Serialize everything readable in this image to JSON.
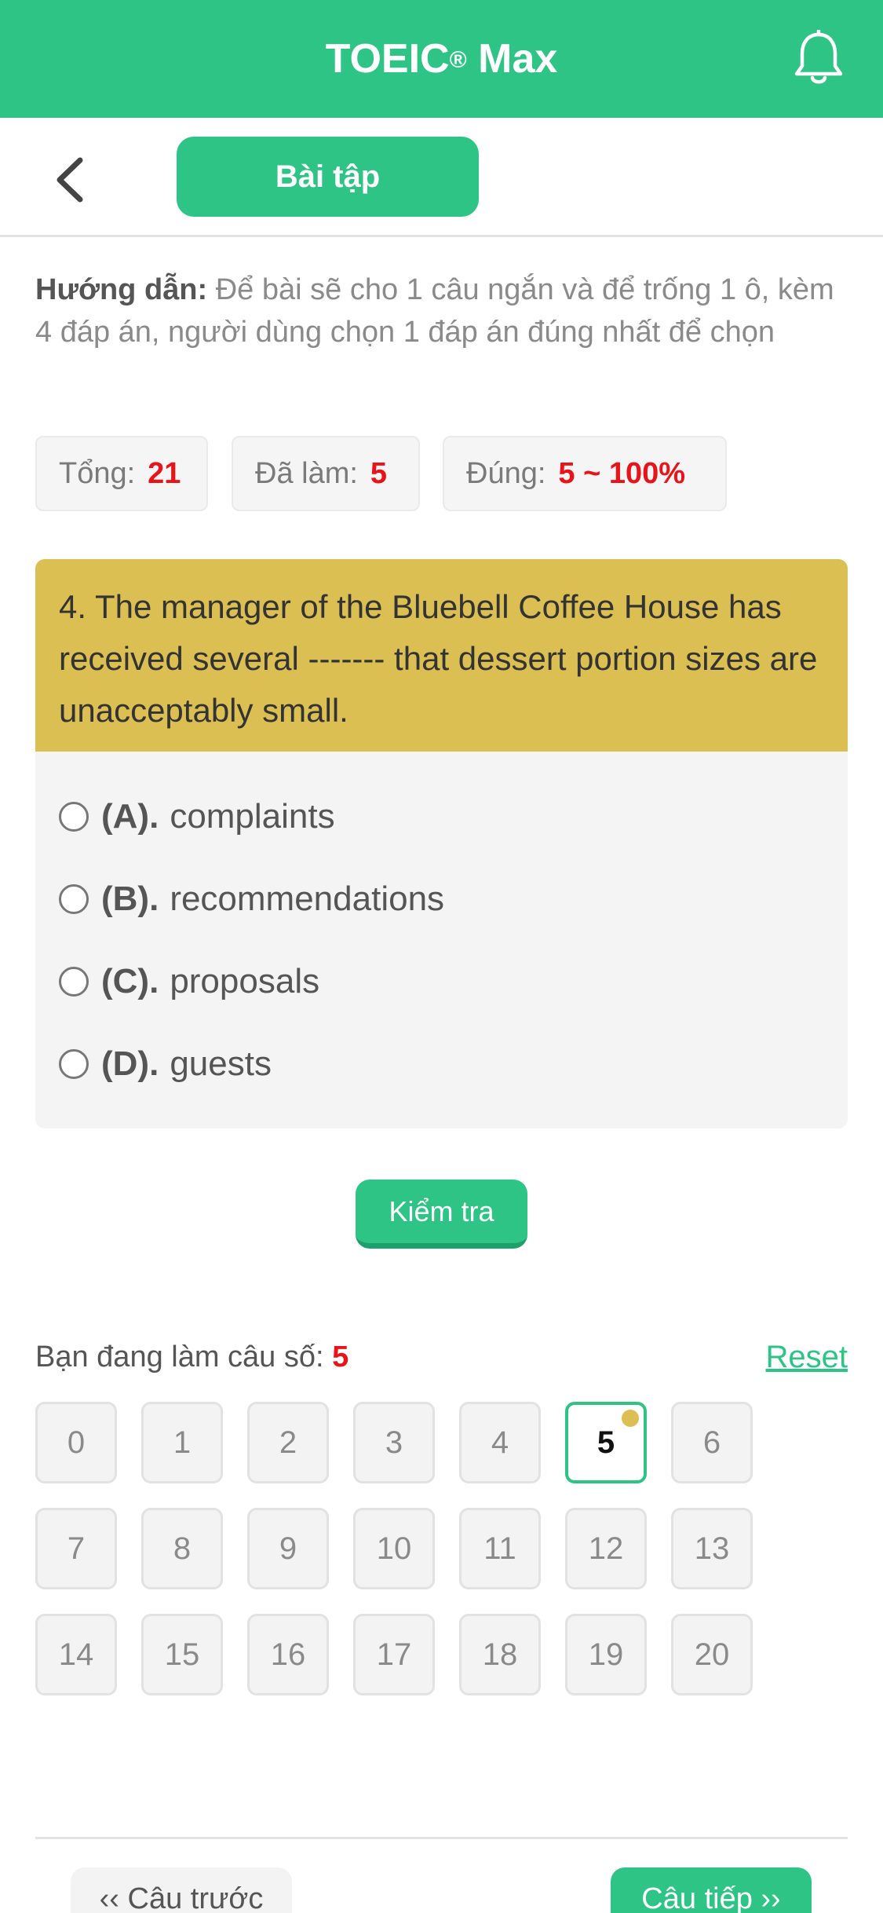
{
  "header": {
    "title": "TOEIC",
    "title_mark": "®",
    "title_suffix": " Max"
  },
  "subbar": {
    "tab_label": "Bài tập"
  },
  "guide": {
    "label": "Hướng dẫn:",
    "text": " Để bài sẽ cho 1 câu ngắn và để trống 1 ô, kèm 4 đáp án, người dùng chọn 1 đáp án đúng nhất để chọn"
  },
  "stats": {
    "total_label": "Tổng:",
    "total_value": "21",
    "done_label": "Đã làm:",
    "done_value": "5",
    "correct_label": "Đúng:",
    "correct_value": "5 ~ 100%"
  },
  "question": {
    "text": "4. The manager of the Bluebell Coffee House has received several ------- that dessert portion sizes are unacceptably small.",
    "options": [
      {
        "letter": "(A).",
        "text": "complaints"
      },
      {
        "letter": "(B).",
        "text": "recommendations"
      },
      {
        "letter": "(C).",
        "text": "proposals"
      },
      {
        "letter": "(D).",
        "text": "guests"
      }
    ]
  },
  "actions": {
    "check_label": "Kiểm tra"
  },
  "navigator": {
    "current_label": "Bạn đang làm câu số: ",
    "current_value": "5",
    "reset_label": "Reset",
    "active_index": 5,
    "numbers": [
      "0",
      "1",
      "2",
      "3",
      "4",
      "5",
      "6",
      "7",
      "8",
      "9",
      "10",
      "11",
      "12",
      "13",
      "14",
      "15",
      "16",
      "17",
      "18",
      "19",
      "20"
    ]
  },
  "footer": {
    "prev_label": "‹‹ Câu trước",
    "next_label": "Câu tiếp ››"
  },
  "colors": {
    "brand": "#2ec486",
    "question_header": "#dbbf52",
    "highlight": "#e8141a"
  }
}
